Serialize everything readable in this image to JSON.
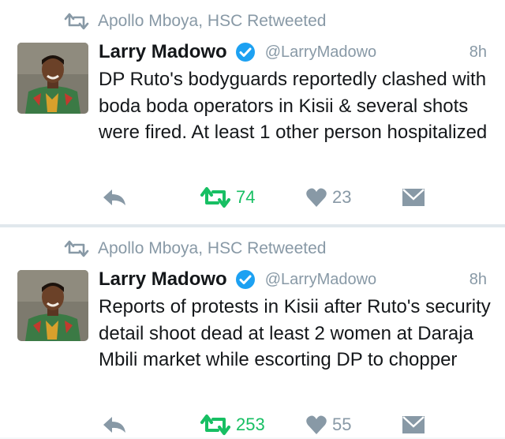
{
  "tweets": [
    {
      "retweeted_by": "Apollo Mboya, HSC Retweeted",
      "name": "Larry Madowo",
      "handle": "@LarryMadowo",
      "time": "8h",
      "text": "DP Ruto's bodyguards reportedly clashed with boda boda operators in Kisii & several shots were fired. At least 1 other person hospitalized",
      "retweets": "74",
      "likes": "23"
    },
    {
      "retweeted_by": "Apollo Mboya, HSC Retweeted",
      "name": "Larry Madowo",
      "handle": "@LarryMadowo",
      "time": "8h",
      "text": "Reports of protests in Kisii after Ruto's security detail shoot dead at least 2 women at Daraja Mbili market while escorting DP to chopper",
      "retweets": "253",
      "likes": "55"
    }
  ],
  "colors": {
    "retweet_green": "#17bf63",
    "meta_grey": "#8899a6",
    "verified_blue": "#1da1f2",
    "text_dark": "#14171a"
  },
  "icons": [
    "retweet-icon",
    "verified-badge-icon",
    "reply-icon",
    "heart-icon",
    "direct-message-icon"
  ]
}
